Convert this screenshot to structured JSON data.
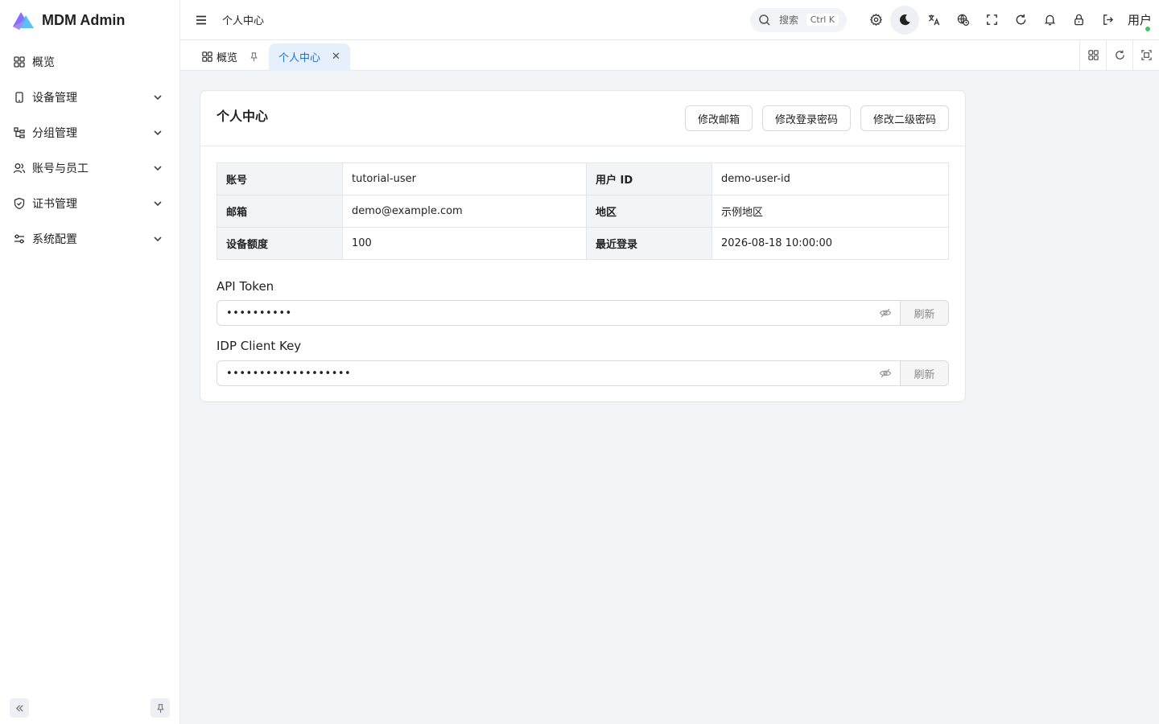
{
  "app": {
    "name": "MDM Admin",
    "brand_colors": [
      "#7b6cf6",
      "#3db8f5",
      "#a57cf8"
    ]
  },
  "sidebar": {
    "items": [
      {
        "label": "概览",
        "icon": "dashboard-icon",
        "expandable": false
      },
      {
        "label": "设备管理",
        "icon": "phone-icon",
        "expandable": true
      },
      {
        "label": "分组管理",
        "icon": "tree-icon",
        "expandable": true
      },
      {
        "label": "账号与员工",
        "icon": "users-icon",
        "expandable": true
      },
      {
        "label": "证书管理",
        "icon": "shield-check-icon",
        "expandable": true
      },
      {
        "label": "系统配置",
        "icon": "sliders-icon",
        "expandable": true
      }
    ]
  },
  "header": {
    "breadcrumb": "个人中心",
    "search": {
      "placeholder": "搜索",
      "shortcut": "Ctrl K"
    },
    "user_label": "用户",
    "online_color": "#43c463"
  },
  "tabs": [
    {
      "label": "概览",
      "active": false
    },
    {
      "label": "个人中心",
      "active": true
    }
  ],
  "accent_color": "#1e6fd9",
  "profile": {
    "title": "个人中心",
    "actions": {
      "change_email": "修改邮箱",
      "change_password": "修改登录密码",
      "change_secondary_password": "修改二级密码"
    },
    "rows": [
      {
        "l1": "账号",
        "v1": "tutorial-user",
        "l2": "用户 ID",
        "v2": "demo-user-id"
      },
      {
        "l1": "邮箱",
        "v1": "demo@example.com",
        "l2": "地区",
        "v2": "示例地区"
      },
      {
        "l1": "设备额度",
        "v1": "100",
        "l2": "最近登录",
        "v2": "2026-08-18 10:00:00"
      }
    ],
    "api_token": {
      "label": "API Token",
      "value": "••••••••••",
      "refresh": "刷新"
    },
    "idp_key": {
      "label": "IDP Client Key",
      "value": "•••••••••••••••••••",
      "refresh": "刷新"
    }
  }
}
